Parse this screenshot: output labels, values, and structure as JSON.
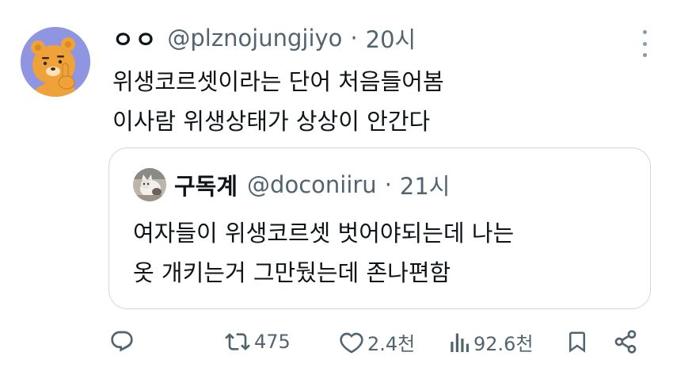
{
  "tweet": {
    "avatar_icon": "bear-character-avatar-icon",
    "display_name": "ㅇㅇ",
    "handle": "@plznojungjiyo",
    "separator": "·",
    "time": "20시",
    "text_lines": [
      "위생코르셋이라는 단어 처음들어봄",
      "이사람 위생상태가 상상이 안간다"
    ]
  },
  "quoted_tweet": {
    "avatar_icon": "cat-photo-avatar-icon",
    "display_name": "구독계",
    "handle": "@doconiiru",
    "separator": "·",
    "time": "21시",
    "text_lines": [
      "여자들이 위생코르셋 벗어야되는데 나는",
      "옷 개키는거 그만뒀는데 존나편함"
    ]
  },
  "actions": {
    "reply_icon": "reply-bubble-icon",
    "retweet_icon": "retweet-icon",
    "retweet_count": "475",
    "like_icon": "heart-icon",
    "like_count": "2.4천",
    "views_icon": "bar-chart-icon",
    "views_count": "92.6천",
    "bookmark_icon": "bookmark-icon",
    "share_icon": "share-icon"
  },
  "colors": {
    "text_primary": "#0f1419",
    "text_secondary": "#536471",
    "border": "#cfd9de",
    "avatar_bg": "#8f95e0",
    "bear_orange": "#f0a23a"
  }
}
